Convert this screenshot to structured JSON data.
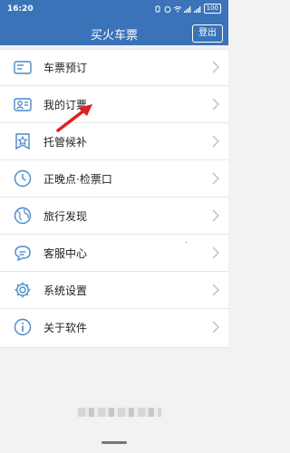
{
  "statusbar": {
    "time": "16:20",
    "battery": "100"
  },
  "header": {
    "title": "买火车票",
    "logout_label": "登出"
  },
  "menu": {
    "items": [
      {
        "label": "车票预订",
        "icon": "ticket-icon"
      },
      {
        "label": "我的订票",
        "icon": "profile-card-icon"
      },
      {
        "label": "托管候补",
        "icon": "star-shield-icon"
      },
      {
        "label": "正晚点·检票口",
        "icon": "clock-icon"
      },
      {
        "label": "旅行发现",
        "icon": "globe-icon"
      },
      {
        "label": "客服中心",
        "icon": "chat-icon"
      },
      {
        "label": "系统设置",
        "icon": "gear-icon"
      },
      {
        "label": "关于软件",
        "icon": "info-icon"
      }
    ]
  },
  "colors": {
    "brand": "#3a73b8",
    "icon": "#4a88c8",
    "annotation": "#e02020"
  }
}
